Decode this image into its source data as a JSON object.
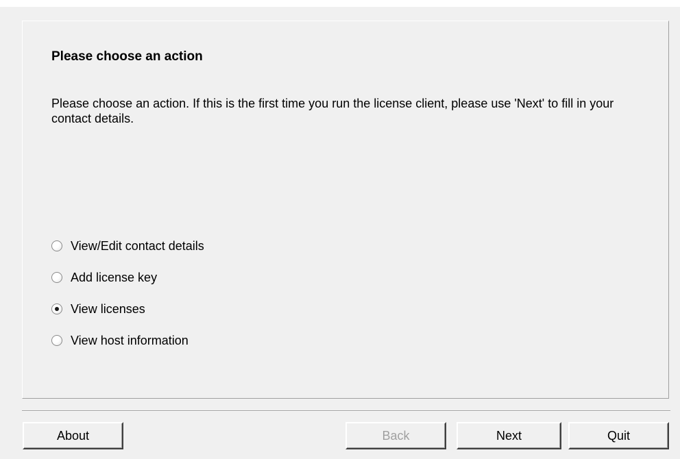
{
  "page": {
    "heading": "Please choose an action",
    "description": "Please choose an action. If this is the first time you run the license client, please use 'Next' to fill in your contact details."
  },
  "options": [
    {
      "label": "View/Edit contact details",
      "selected": false
    },
    {
      "label": "Add license key",
      "selected": false
    },
    {
      "label": "View licenses",
      "selected": true
    },
    {
      "label": "View host information",
      "selected": false
    }
  ],
  "buttons": {
    "about": "About",
    "back": "Back",
    "next": "Next",
    "quit": "Quit"
  },
  "colors": {
    "dialog_background": "#f0f0f0",
    "disabled_text": "#a0a0a0"
  }
}
